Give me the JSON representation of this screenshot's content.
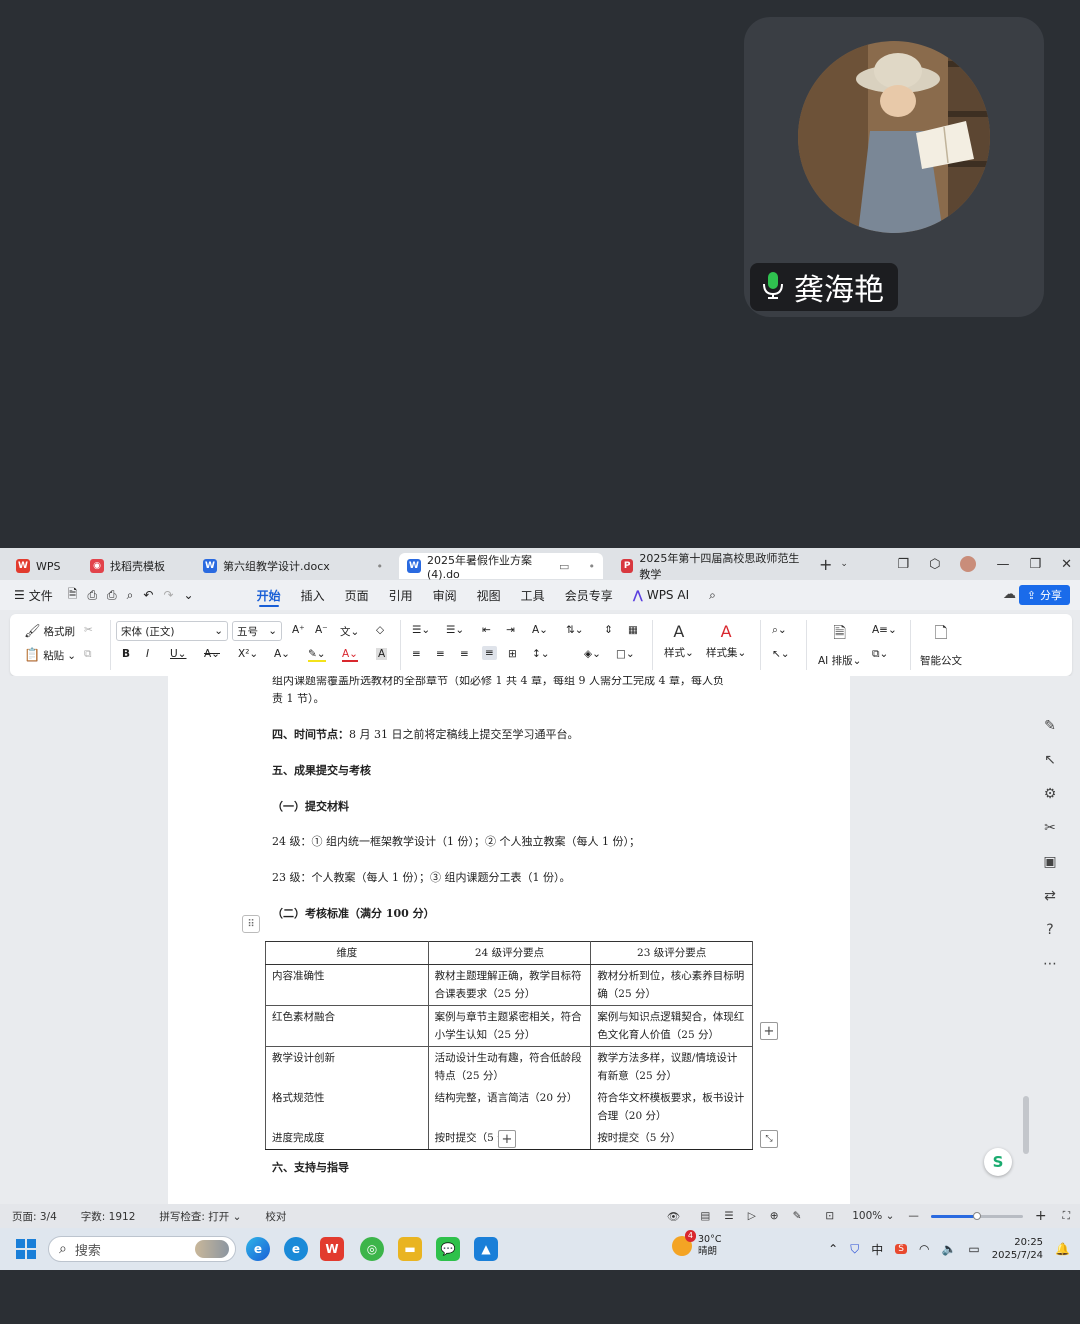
{
  "call": {
    "participant_name": "龚海艳"
  },
  "tabs": [
    {
      "label": "WPS",
      "logo": "W",
      "color": "#e23b2e"
    },
    {
      "label": "找稻壳模板",
      "logo": "◉",
      "color": "#e2434b"
    },
    {
      "label": "第六组教学设计.docx",
      "logo": "W",
      "color": "#2a6ae0"
    },
    {
      "label": "2025年暑假作业方案(4).do",
      "logo": "W",
      "color": "#2a6ae0"
    },
    {
      "label": "2025年第十四届高校思政师范生教学",
      "logo": "P",
      "color": "#d8383f"
    }
  ],
  "menu": {
    "file": "文件",
    "items": [
      "开始",
      "插入",
      "页面",
      "引用",
      "审阅",
      "视图",
      "工具",
      "会员专享"
    ],
    "wps_ai": "WPS AI",
    "share": "分享"
  },
  "ribbon": {
    "format_painter": "格式刷",
    "paste": "粘贴",
    "font_name": "宋体 (正文)",
    "font_size": "五号",
    "styles": "样式",
    "style_set": "样式集",
    "ai_layout": "AI 排版",
    "smart_doc": "智能公文"
  },
  "doc": {
    "line1": "组内课题需覆盖所选教材的全部章节（如必修 1 共 4 章，每组 9 人需分工完成 4 章，每人负",
    "line2": "责 1 节）。",
    "section4_label": "四、时间节点：",
    "section4_text": "8 月 31 日之前将定稿线上提交至学习通平台。",
    "section5": "五、成果提交与考核",
    "sub1": "（一）提交材料",
    "grade24": "24 级：① 组内统一框架教学设计（1 份）；② 个人独立教案（每人 1 份）；",
    "grade23": "23 级：个人教案（每人 1 份）；③ 组内课题分工表（1 份）。",
    "sub2": "（二）考核标准（满分 100 分）",
    "table": {
      "headers": [
        "维度",
        "24 级评分要点",
        "23 级评分要点"
      ],
      "rows": [
        [
          "内容准确性",
          "教材主题理解正确，教学目标符合课表要求（25 分）",
          "教材分析到位，核心素养目标明确（25 分）"
        ],
        [
          "红色素材融合",
          "案例与章节主题紧密相关，符合小学生认知（25 分）",
          "案例与知识点逻辑契合，体现红色文化育人价值（25 分）"
        ],
        [
          "教学设计创新",
          "活动设计生动有趣，符合低龄段特点（25 分）",
          "教学方法多样，议题/情境设计有新意（25 分）"
        ],
        [
          "格式规范性",
          "结构完整，语言简洁（20 分）",
          "符合华文杯模板要求，板书设计合理（20 分）"
        ],
        [
          "进度完成度",
          "按时提交（5 分）",
          "按时提交（5 分）"
        ]
      ]
    },
    "section6": "六、支持与指导"
  },
  "status": {
    "page": "页面: 3/4",
    "words": "字数: 1912",
    "spellcheck": "拼写检查: 打开",
    "proof": "校对",
    "zoom": "100%",
    "zoom_fraction": 0.5
  },
  "taskbar": {
    "search": "搜索",
    "weather_temp": "30°C",
    "weather_desc": "晴朗",
    "weather_badge": "4",
    "ime": "中",
    "time": "20:25",
    "date": "2025/7/24"
  }
}
